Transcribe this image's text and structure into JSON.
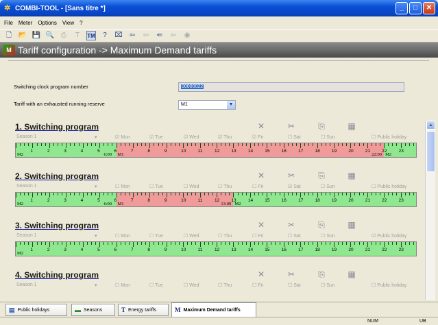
{
  "window": {
    "title": "COMBI-TOOL - [Sans titre *]"
  },
  "menu": [
    "File",
    "Meter",
    "Options",
    "View",
    "?"
  ],
  "header": {
    "title": "Tariff configuration -> Maximum Demand tariffs",
    "logo_text": "M"
  },
  "settings": {
    "clock_label": "Switching clock program number",
    "clock_value": "00000022",
    "exhausted_label": "Tariff with an exhausted running reserve",
    "exhausted_value": "M1"
  },
  "days": [
    "Mon",
    "Tue",
    "Wed",
    "Thu",
    "Fri",
    "Sat",
    "Sun",
    "Public holiday"
  ],
  "season_label": "Season 1",
  "programs": [
    {
      "title": "1. Switching program",
      "checked": [
        true,
        true,
        true,
        true,
        true,
        false,
        false,
        false
      ],
      "segments": [
        {
          "from": 0,
          "to": 6,
          "tariff": "M2"
        },
        {
          "from": 6,
          "to": 22,
          "tariff": "M1"
        },
        {
          "from": 22,
          "to": 24,
          "tariff": "M2"
        }
      ],
      "switch_labels": [
        "6:00",
        "22:00"
      ]
    },
    {
      "title": "2. Switching program",
      "checked": [
        false,
        false,
        false,
        false,
        false,
        true,
        false,
        false
      ],
      "segments": [
        {
          "from": 0,
          "to": 6,
          "tariff": "M2"
        },
        {
          "from": 6,
          "to": 13,
          "tariff": "M1"
        },
        {
          "from": 13,
          "to": 24,
          "tariff": "M2"
        }
      ],
      "switch_labels": [
        "6:00",
        "13:00"
      ]
    },
    {
      "title": "3. Switching program",
      "checked": [
        false,
        false,
        false,
        false,
        false,
        false,
        false,
        true
      ],
      "segments": [
        {
          "from": 0,
          "to": 24,
          "tariff": "M2"
        }
      ],
      "switch_labels": []
    },
    {
      "title": "4. Switching program",
      "checked": [
        false,
        false,
        false,
        false,
        false,
        false,
        false,
        false
      ],
      "segments": [],
      "switch_labels": []
    }
  ],
  "tabs": [
    "Public holidays",
    "Seasons",
    "Energy tariffs",
    "Maximum Demand tariffs"
  ],
  "tab_icons": [
    "",
    "",
    "T",
    "M"
  ],
  "status": {
    "num": "NUM",
    "lang": "UB"
  },
  "colors": {
    "tariff_m1": "#f09a9a",
    "tariff_m2": "#8fe88f",
    "header_bg": "#5a5a5a"
  }
}
